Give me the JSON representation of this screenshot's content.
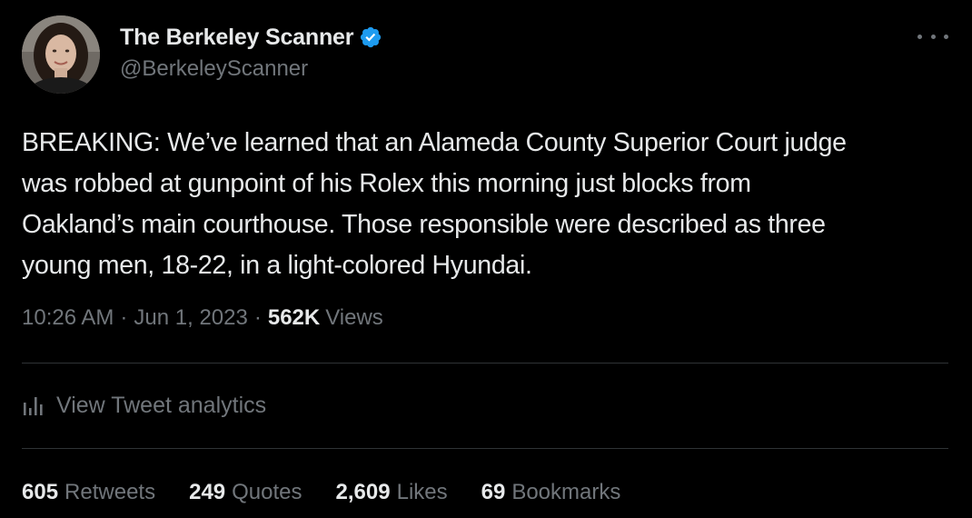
{
  "author": {
    "display_name": "The Berkeley Scanner",
    "handle": "@BerkeleyScanner",
    "verified": true,
    "avatar_icon": "profile-photo"
  },
  "more_icon": "more-horizontal-icon",
  "tweet": {
    "lines": [
      "BREAKING: We’ve learned that an Alameda County Superior Court judge",
      "was robbed at gunpoint of his Rolex this morning just blocks from",
      "Oakland’s main courthouse. Those responsible were described as three",
      "young men, 18-22, in a light-colored Hyundai."
    ]
  },
  "meta": {
    "time": "10:26 AM",
    "separator": "·",
    "date": "Jun 1, 2023",
    "views_count": "562K",
    "views_label": "Views"
  },
  "analytics": {
    "label": "View Tweet analytics",
    "icon": "analytics-bar-icon"
  },
  "stats": [
    {
      "count": "605",
      "label": "Retweets"
    },
    {
      "count": "249",
      "label": "Quotes"
    },
    {
      "count": "2,609",
      "label": "Likes"
    },
    {
      "count": "69",
      "label": "Bookmarks"
    }
  ],
  "colors": {
    "background": "#000000",
    "primary_text": "#e7e9ea",
    "secondary_text": "#71767b",
    "verified_blue": "#1d9bf0",
    "divider": "#2f3336"
  }
}
